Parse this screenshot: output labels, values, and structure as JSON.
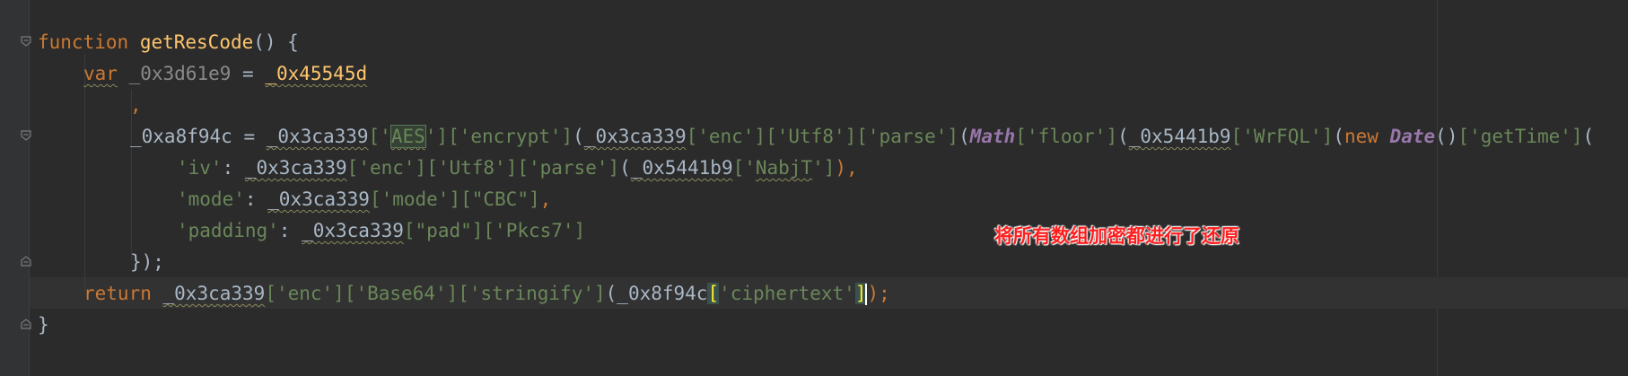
{
  "editor": {
    "lines": [
      {
        "tokens": [
          "function",
          " ",
          "getResCode",
          "() {"
        ]
      },
      {
        "tokens": [
          "var",
          " ",
          "_0x3d61e9",
          " = ",
          "_0x45545d"
        ]
      },
      {
        "tokens": [
          ","
        ]
      },
      {
        "tokens": [
          "_0xa8f94c",
          " = ",
          "_0x3ca339",
          "['",
          "AES",
          "']",
          "['encrypt']",
          "(",
          "_0x3ca339",
          "['enc']",
          "['Utf8']",
          "['parse']",
          "(",
          "Math",
          "['floor']",
          "(",
          "_0x5441b9",
          "['WrFQL']",
          "(",
          "new",
          " ",
          "Date",
          "()",
          "['getTime']",
          "("
        ]
      },
      {
        "tokens": [
          "'iv'",
          ": ",
          "_0x3ca339",
          "['enc']",
          "['Utf8']",
          "['parse']",
          "(",
          "_0x5441b9",
          "['",
          "NabjT",
          "']",
          "),"
        ]
      },
      {
        "tokens": [
          "'mode'",
          ": ",
          "_0x3ca339",
          "['mode']",
          "[\"CBC\"]",
          ","
        ]
      },
      {
        "tokens": [
          "'padding'",
          ": ",
          "_0x3ca339",
          "[\"pad\"]",
          "['Pkcs7']"
        ]
      },
      {
        "tokens": [
          "});"
        ]
      },
      {
        "tokens": [
          "return",
          " ",
          "_0x3ca339",
          "['enc']",
          "['Base64']",
          "['stringify']",
          "(",
          "_0x8f94c",
          "[",
          "'ciphertext'",
          "]",
          ");"
        ]
      },
      {
        "tokens": [
          "}"
        ]
      }
    ]
  },
  "annotation": {
    "text": "将所有数组加密都进行了还原",
    "color": "#ff1e1e"
  },
  "colors": {
    "background": "#2b2b2b",
    "keyword": "#cc7832",
    "function": "#ffc66d",
    "string": "#6a8759"
  }
}
